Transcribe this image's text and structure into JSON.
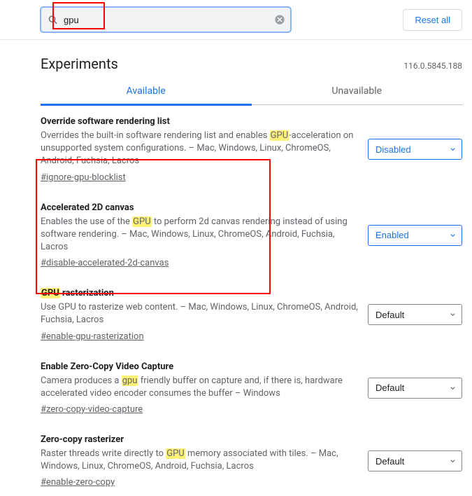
{
  "search": {
    "value": "gpu",
    "placeholder": "Search flags"
  },
  "topbar": {
    "reset_label": "Reset all"
  },
  "page": {
    "title": "Experiments",
    "version": "116.0.5845.188"
  },
  "tabs": {
    "available": "Available",
    "unavailable": "Unavailable"
  },
  "flags": [
    {
      "title_pre": "Override software rendering list",
      "title_hl": "",
      "title_post": "",
      "desc_pre": "Overrides the built-in software rendering list and enables ",
      "desc_hl": "GPU",
      "desc_post": "-acceleration on unsupported system configurations. – Mac, Windows, Linux, ChromeOS, Android, Fuchsia, Lacros",
      "hash": "#ignore-gpu-blocklist",
      "select_value": "Disabled",
      "select_color": "blue"
    },
    {
      "title_pre": "Accelerated 2D canvas",
      "title_hl": "",
      "title_post": "",
      "desc_pre": "Enables the use of the ",
      "desc_hl": "GPU",
      "desc_post": " to perform 2d canvas rendering instead of using software rendering. – Mac, Windows, Linux, ChromeOS, Android, Fuchsia, Lacros",
      "hash": "#disable-accelerated-2d-canvas",
      "select_value": "Enabled",
      "select_color": "blue"
    },
    {
      "title_pre": "",
      "title_hl": "GPU",
      "title_post": " rasterization",
      "desc_pre": "Use GPU to rasterize web content. – Mac, Windows, Linux, ChromeOS, Android, Fuchsia, Lacros",
      "desc_hl": "",
      "desc_post": "",
      "hash": "#enable-gpu-rasterization",
      "select_value": "Default",
      "select_color": "default"
    },
    {
      "title_pre": "Enable Zero-Copy Video Capture",
      "title_hl": "",
      "title_post": "",
      "desc_pre": "Camera produces a ",
      "desc_hl": "gpu",
      "desc_post": " friendly buffer on capture and, if there is, hardware accelerated video encoder consumes the buffer – Windows",
      "hash": "#zero-copy-video-capture",
      "select_value": "Default",
      "select_color": "default"
    },
    {
      "title_pre": "Zero-copy rasterizer",
      "title_hl": "",
      "title_post": "",
      "desc_pre": "Raster threads write directly to ",
      "desc_hl": "GPU",
      "desc_post": " memory associated with tiles. – Mac, Windows, Linux, ChromeOS, Android, Fuchsia, Lacros",
      "hash": "#enable-zero-copy",
      "select_value": "Default",
      "select_color": "default"
    }
  ]
}
